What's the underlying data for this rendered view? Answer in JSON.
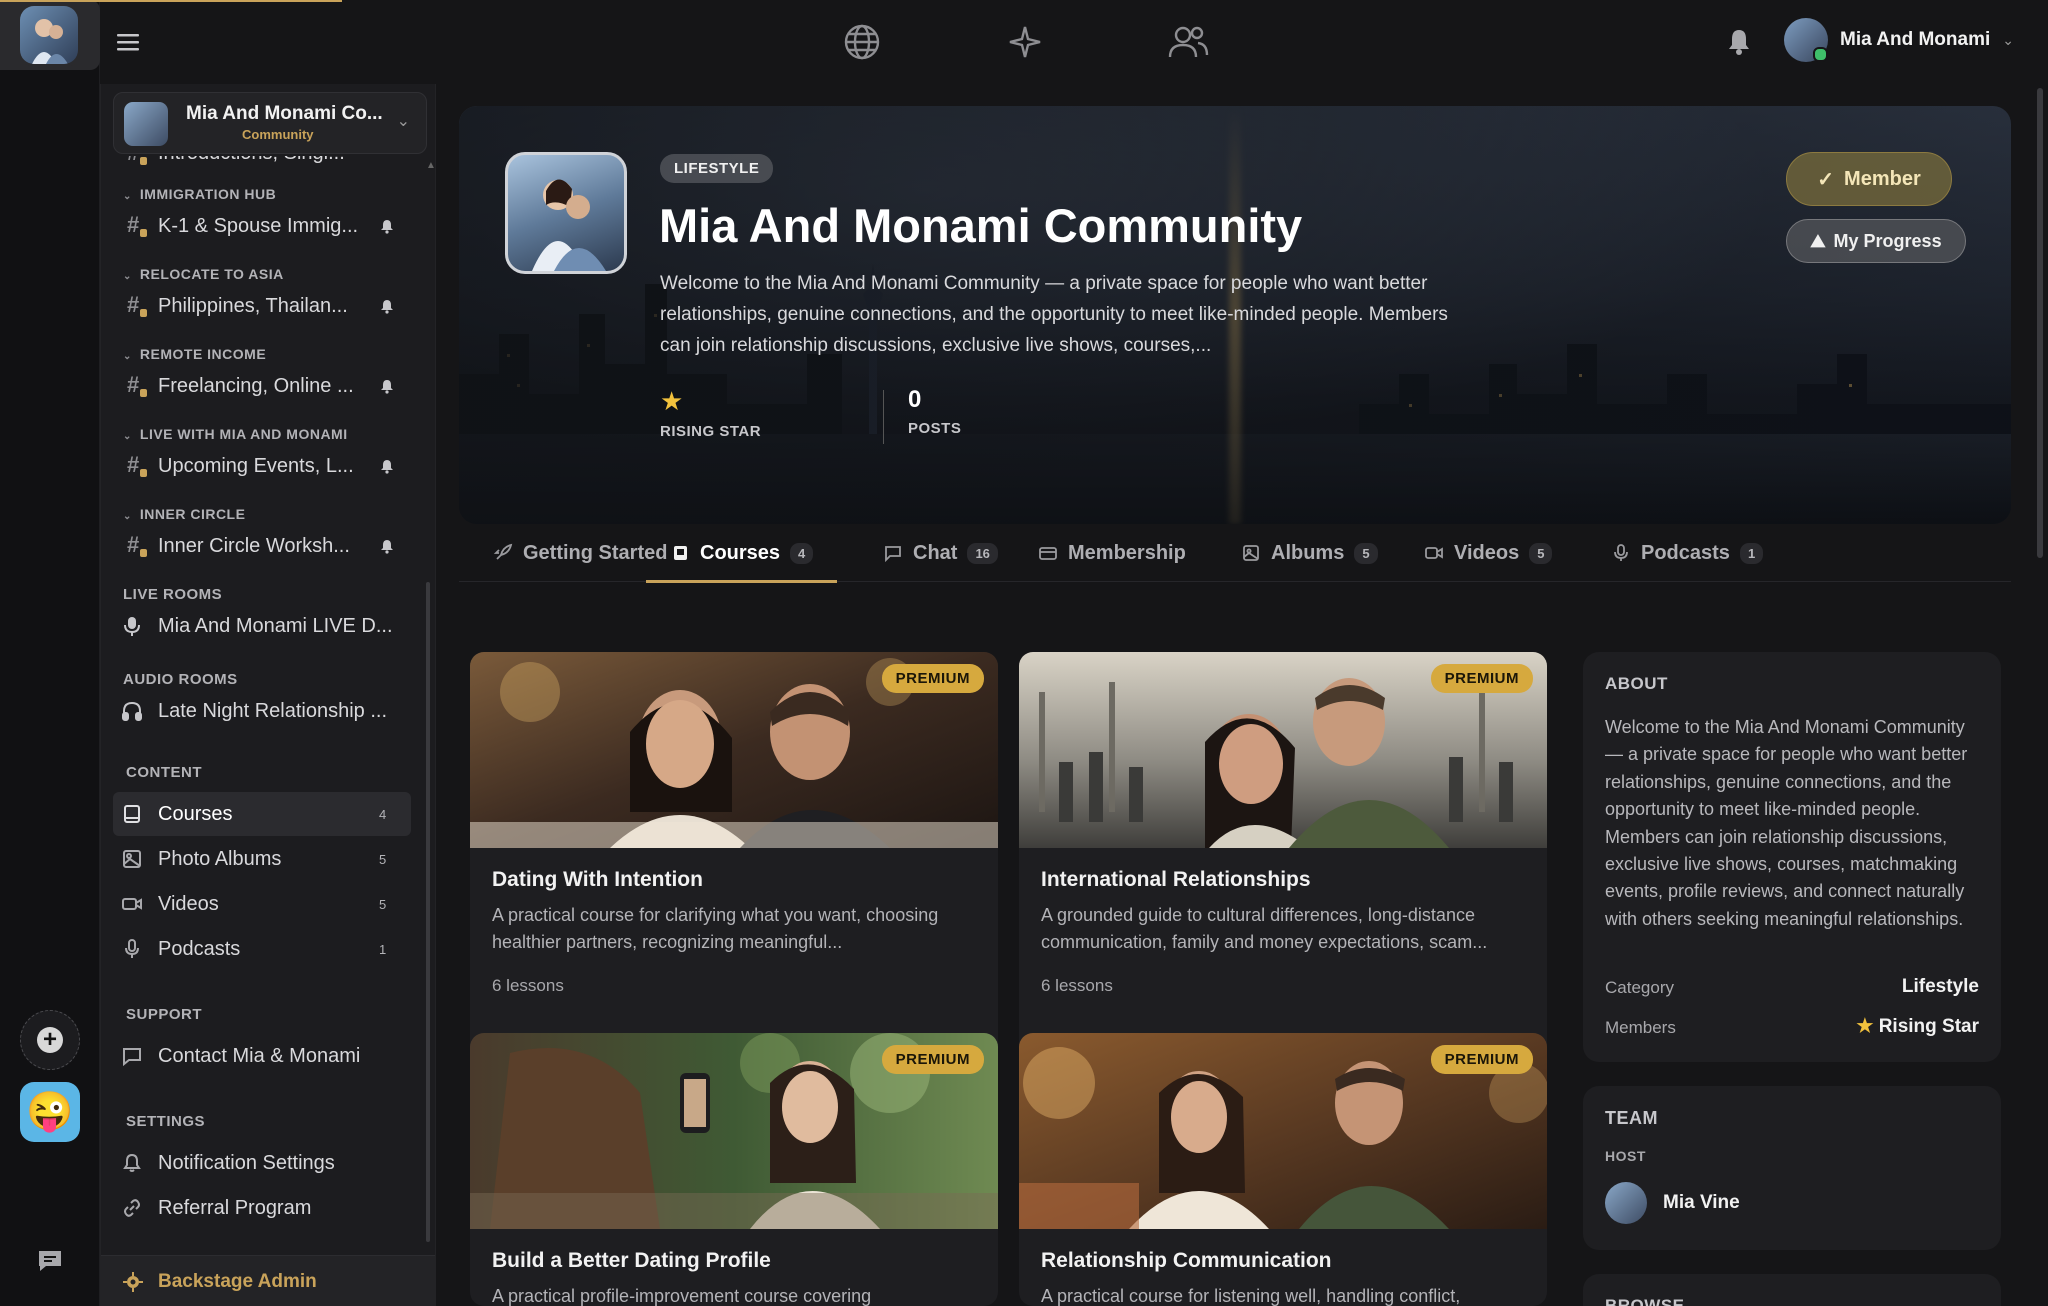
{
  "app": {
    "user_name": "Mia And Monami",
    "brand_color": "#c9a35a"
  },
  "rail": {
    "icons": [
      "m-logo-icon",
      "plus-icon",
      "emoji-avatar",
      "community-avatar",
      "chat-bubble-icon"
    ]
  },
  "topnav": {
    "icons": [
      "globe-icon",
      "sparkle-icon",
      "people-icon"
    ]
  },
  "community": {
    "name": "Mia And Monami Co...",
    "type": "Community"
  },
  "sidebar": {
    "top_cut_label": "Introductions, Singl...",
    "groups": [
      {
        "category": "IMMIGRATION HUB",
        "channel": "K-1 & Spouse Immig..."
      },
      {
        "category": "RELOCATE TO ASIA",
        "channel": "Philippines, Thailan..."
      },
      {
        "category": "REMOTE INCOME",
        "channel": "Freelancing, Online ..."
      },
      {
        "category": "LIVE WITH MIA AND MONAMI",
        "channel": "Upcoming Events, L..."
      },
      {
        "category": "INNER CIRCLE",
        "channel": "Inner Circle Worksh..."
      }
    ],
    "live_rooms": {
      "heading": "LIVE ROOMS",
      "item": "Mia And Monami LIVE D..."
    },
    "audio_rooms": {
      "heading": "AUDIO ROOMS",
      "item": "Late Night Relationship ..."
    },
    "content": {
      "heading": "CONTENT",
      "items": [
        {
          "label": "Courses",
          "count": "4"
        },
        {
          "label": "Photo Albums",
          "count": "5"
        },
        {
          "label": "Videos",
          "count": "5"
        },
        {
          "label": "Podcasts",
          "count": "1"
        }
      ]
    },
    "support": {
      "heading": "SUPPORT",
      "item": "Contact Mia & Monami"
    },
    "settings": {
      "heading": "SETTINGS",
      "items": [
        "Notification Settings",
        "Referral Program"
      ]
    },
    "backstage": "Backstage Admin"
  },
  "hero": {
    "badge": "LIFESTYLE",
    "title": "Mia And Monami Community",
    "description": "Welcome to the Mia And Monami Community — a private space for people who want better relationships, genuine connections, and the opportunity to meet like-minded people. Members can join relationship discussions, exclusive live shows, courses,...",
    "stat_rank_label": "RISING STAR",
    "posts_value": "0",
    "posts_label": "POSTS",
    "member_button": "Member",
    "progress_button": "My Progress"
  },
  "tabs": [
    {
      "label": "Getting Started",
      "count": ""
    },
    {
      "label": "Courses",
      "count": "4"
    },
    {
      "label": "Chat",
      "count": "16"
    },
    {
      "label": "Membership",
      "count": ""
    },
    {
      "label": "Albums",
      "count": "5"
    },
    {
      "label": "Videos",
      "count": "5"
    },
    {
      "label": "Podcasts",
      "count": "1"
    }
  ],
  "courses": [
    {
      "badge": "PREMIUM",
      "title": "Dating With Intention",
      "description": "A practical course for clarifying what you want, choosing healthier partners, recognizing meaningful...",
      "lessons": "6 lessons"
    },
    {
      "badge": "PREMIUM",
      "title": "International Relationships",
      "description": "A grounded guide to cultural differences, long-distance communication, family and money expectations, scam...",
      "lessons": "6 lessons"
    },
    {
      "badge": "PREMIUM",
      "title": "Build a Better Dating Profile",
      "description": "A practical profile-improvement course covering"
    },
    {
      "badge": "PREMIUM",
      "title": "Relationship Communication",
      "description": "A practical course for listening well, handling conflict,"
    }
  ],
  "about": {
    "heading": "ABOUT",
    "description": "Welcome to the Mia And Monami Community — a private space for people who want better relationships, genuine connections, and the opportunity to meet like-minded people. Members can join relationship discussions, exclusive live shows, courses, matchmaking events, profile reviews, and connect naturally with others seeking meaningful relationships.",
    "category_label": "Category",
    "category_value": "Lifestyle",
    "members_label": "Members",
    "members_value": "Rising Star"
  },
  "team": {
    "heading": "TEAM",
    "host_label": "HOST",
    "host_name": "Mia Vine"
  },
  "browse": {
    "heading": "BROWSE"
  }
}
